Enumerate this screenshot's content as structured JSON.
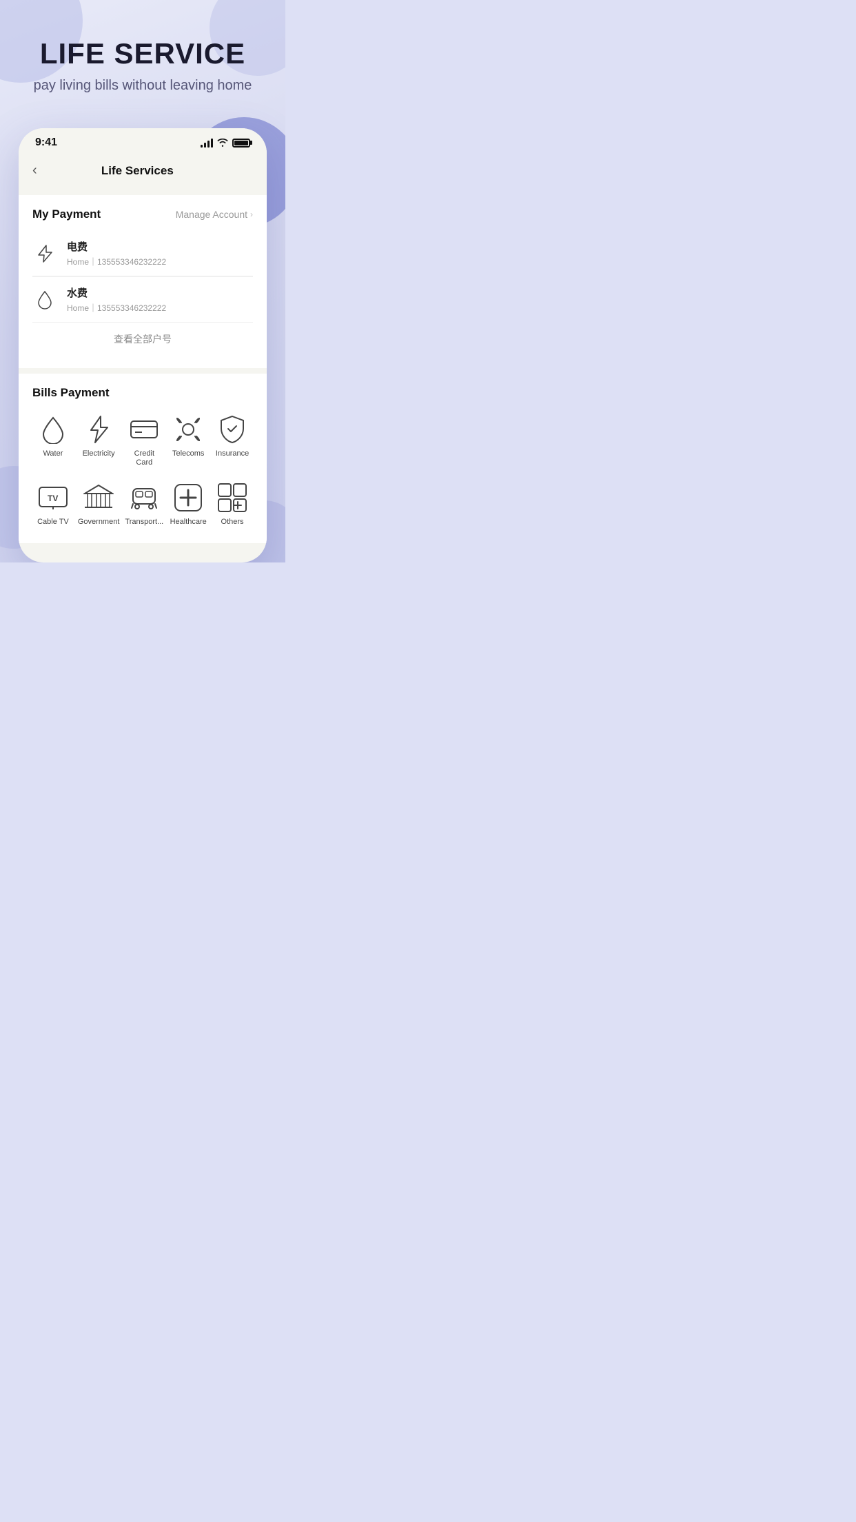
{
  "app": {
    "hero_title": "LIFE SERVICE",
    "hero_subtitle": "pay living bills without leaving home"
  },
  "status_bar": {
    "time": "9:41"
  },
  "nav": {
    "title": "Life Services",
    "back_label": "‹"
  },
  "my_payment": {
    "section_title": "My Payment",
    "manage_label": "Manage Account",
    "items": [
      {
        "name": "电费",
        "detail": "Home｜135553346232222",
        "icon": "lightning"
      },
      {
        "name": "水费",
        "detail": "Home｜135553346232222",
        "icon": "water"
      }
    ],
    "view_all_label": "查看全部户号"
  },
  "bills_payment": {
    "section_title": "Bills Payment",
    "items": [
      {
        "label": "Water",
        "icon": "water"
      },
      {
        "label": "Electricity",
        "icon": "lightning"
      },
      {
        "label": "Credit Card",
        "icon": "creditcard"
      },
      {
        "label": "Telecoms",
        "icon": "telecoms"
      },
      {
        "label": "Insurance",
        "icon": "shield"
      },
      {
        "label": "Cable TV",
        "icon": "tv"
      },
      {
        "label": "Government",
        "icon": "government"
      },
      {
        "label": "Transport...",
        "icon": "transport"
      },
      {
        "label": "Healthcare",
        "icon": "healthcare"
      },
      {
        "label": "Others",
        "icon": "others"
      }
    ]
  }
}
